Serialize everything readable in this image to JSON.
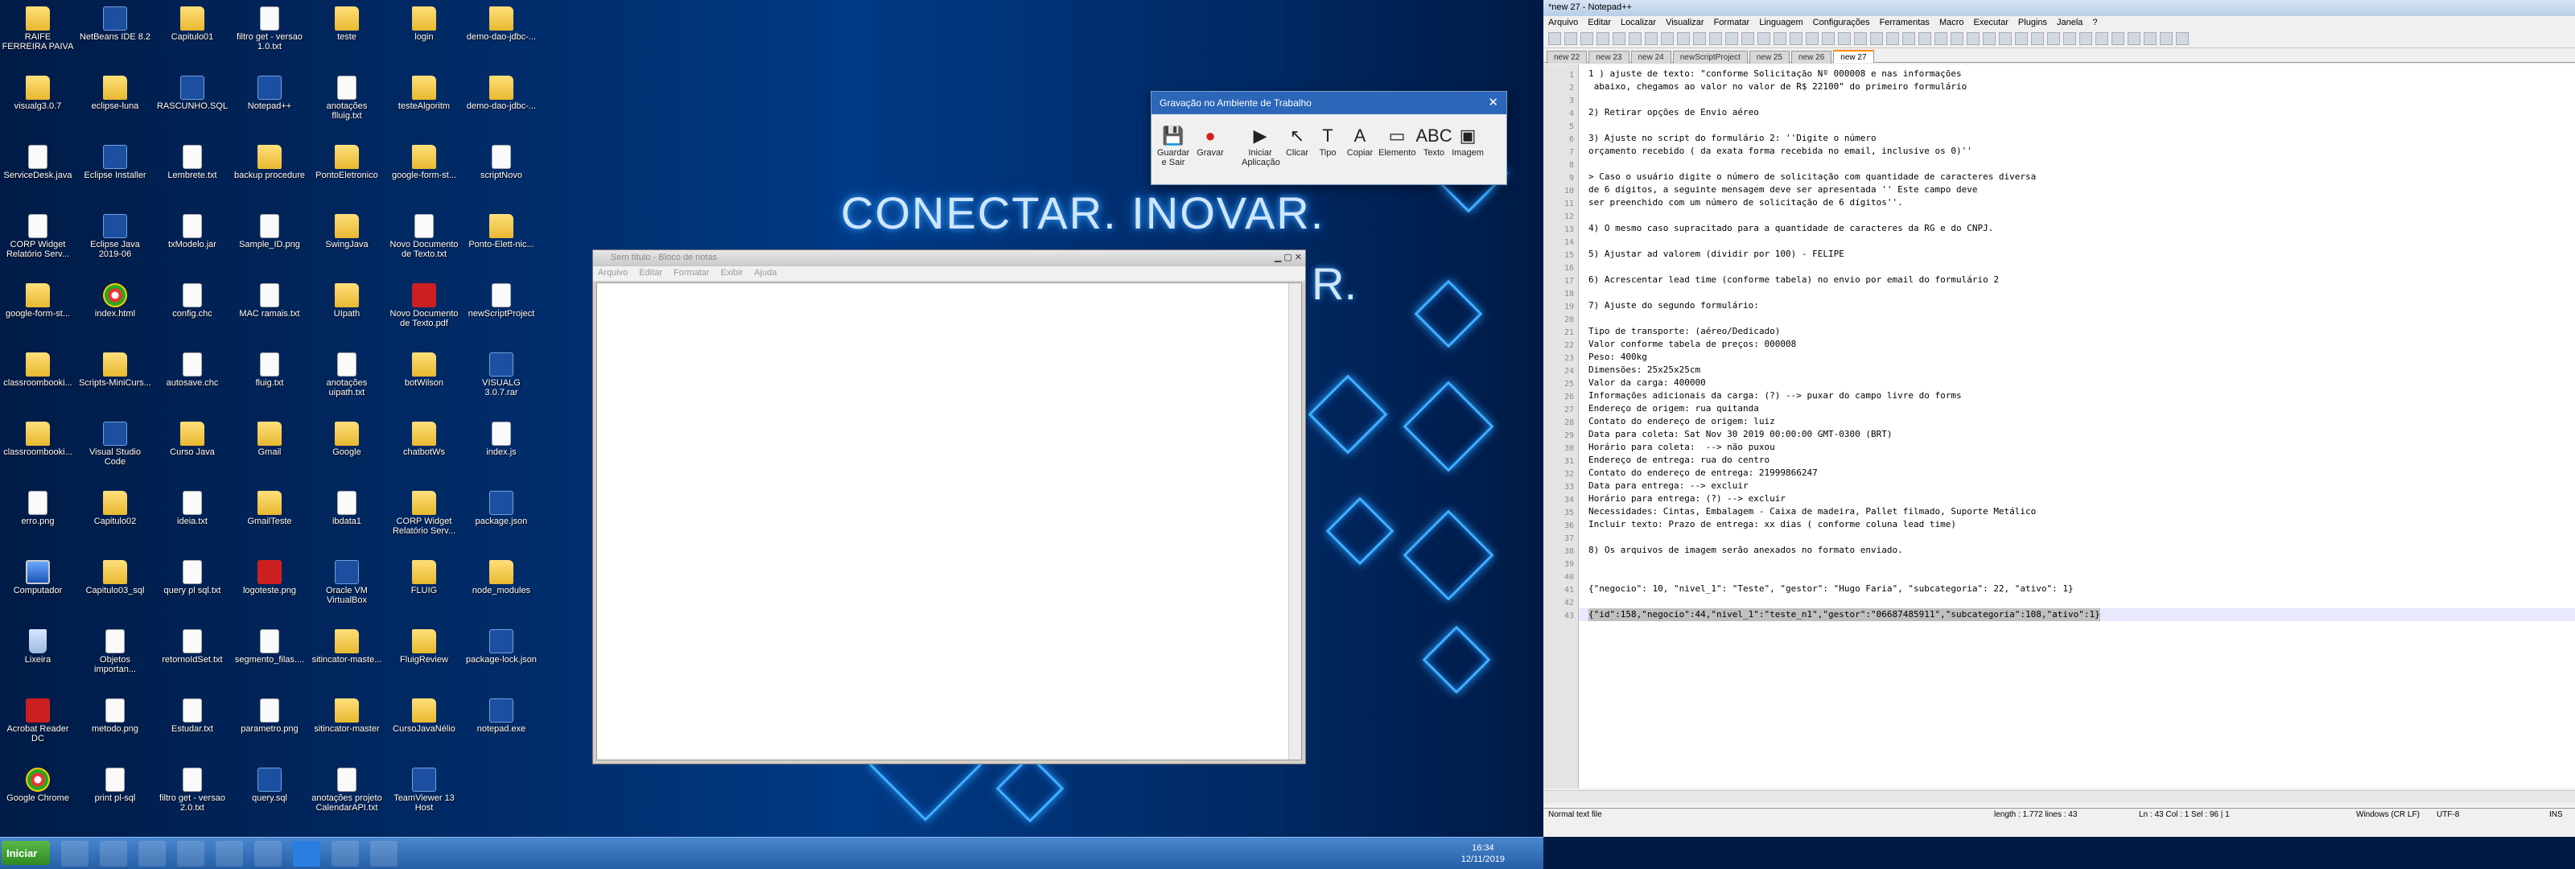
{
  "desktop": {
    "wallpaper_line1": "CONECTAR. INOVAR.",
    "wallpaper_line2": "R.",
    "icons": [
      {
        "label": "RAIFE FERREIRA PAIVA",
        "kind": "folder"
      },
      {
        "label": "NetBeans IDE 8.2",
        "kind": "app"
      },
      {
        "label": "Capitulo01",
        "kind": "folder"
      },
      {
        "label": "filtro get - versao 1.0.txt",
        "kind": "file"
      },
      {
        "label": "teste",
        "kind": "folder"
      },
      {
        "label": "login",
        "kind": "folder"
      },
      {
        "label": "demo-dao-jdbc-...",
        "kind": "folder"
      },
      {
        "label": "visualg3.0.7",
        "kind": "folder"
      },
      {
        "label": "eclipse-luna",
        "kind": "folder"
      },
      {
        "label": "RASCUNHO.SQL",
        "kind": "app"
      },
      {
        "label": "Notepad++",
        "kind": "app"
      },
      {
        "label": "anotações flluig.txt",
        "kind": "file"
      },
      {
        "label": "testeAlgoritm",
        "kind": "folder"
      },
      {
        "label": "demo-dao-jdbc-...",
        "kind": "folder"
      },
      {
        "label": "ServiceDesk.java",
        "kind": "file"
      },
      {
        "label": "Eclipse Installer",
        "kind": "app"
      },
      {
        "label": "Lembrete.txt",
        "kind": "file"
      },
      {
        "label": "backup procedure",
        "kind": "folder"
      },
      {
        "label": "PontoEletronico",
        "kind": "folder"
      },
      {
        "label": "google-form-st...",
        "kind": "folder"
      },
      {
        "label": "scriptNovo",
        "kind": "file"
      },
      {
        "label": "CORP Widget Relatório Serv...",
        "kind": "file"
      },
      {
        "label": "Eclipse Java 2019-06",
        "kind": "app"
      },
      {
        "label": "txModelo.jar",
        "kind": "file"
      },
      {
        "label": "Sample_ID.png",
        "kind": "file"
      },
      {
        "label": "SwingJava",
        "kind": "folder"
      },
      {
        "label": "Novo Documento de Texto.txt",
        "kind": "file"
      },
      {
        "label": "Ponto-Elett-nic...",
        "kind": "folder"
      },
      {
        "label": "google-form-st...",
        "kind": "folder"
      },
      {
        "label": "index.html",
        "kind": "web"
      },
      {
        "label": "config.chc",
        "kind": "file"
      },
      {
        "label": "MAC ramais.txt",
        "kind": "file"
      },
      {
        "label": "UIpath",
        "kind": "folder"
      },
      {
        "label": "Novo Documento de Texto.pdf",
        "kind": "red"
      },
      {
        "label": "newScriptProject",
        "kind": "file"
      },
      {
        "label": "classroombooki...",
        "kind": "folder"
      },
      {
        "label": "Scripts-MiniCurs...",
        "kind": "folder"
      },
      {
        "label": "autosave.chc",
        "kind": "file"
      },
      {
        "label": "fluig.txt",
        "kind": "file"
      },
      {
        "label": "anotações uipath.txt",
        "kind": "file"
      },
      {
        "label": "botWilson",
        "kind": "folder"
      },
      {
        "label": "VISUALG 3.0.7.rar",
        "kind": "app"
      },
      {
        "label": "classroombooki...",
        "kind": "folder"
      },
      {
        "label": "Visual Studio Code",
        "kind": "app"
      },
      {
        "label": "Curso Java",
        "kind": "folder"
      },
      {
        "label": "Gmail",
        "kind": "folder"
      },
      {
        "label": "Google",
        "kind": "folder"
      },
      {
        "label": "chatbotWs",
        "kind": "folder"
      },
      {
        "label": "index.js",
        "kind": "file"
      },
      {
        "label": "erro.png",
        "kind": "file"
      },
      {
        "label": "Capitulo02",
        "kind": "folder"
      },
      {
        "label": "ideia.txt",
        "kind": "file"
      },
      {
        "label": "GmailTeste",
        "kind": "folder"
      },
      {
        "label": "ibdata1",
        "kind": "file"
      },
      {
        "label": "CORP Widget Relatório Serv...",
        "kind": "folder"
      },
      {
        "label": "package.json",
        "kind": "app"
      },
      {
        "label": "Computador",
        "kind": "pc"
      },
      {
        "label": "Capitulo03_sql",
        "kind": "folder"
      },
      {
        "label": "query pl sql.txt",
        "kind": "file"
      },
      {
        "label": "logoteste.png",
        "kind": "red"
      },
      {
        "label": "Oracle VM VirtualBox",
        "kind": "app"
      },
      {
        "label": "FLUIG",
        "kind": "folder"
      },
      {
        "label": "node_modules",
        "kind": "folder"
      },
      {
        "label": "Lixeira",
        "kind": "trash"
      },
      {
        "label": "Objetos importan...",
        "kind": "file"
      },
      {
        "label": "retornoIdSet.txt",
        "kind": "file"
      },
      {
        "label": "segmento_filas....",
        "kind": "file"
      },
      {
        "label": "sitincator-maste...",
        "kind": "folder"
      },
      {
        "label": "FluigReview",
        "kind": "folder"
      },
      {
        "label": "package-lock.json",
        "kind": "app"
      },
      {
        "label": "Acrobat Reader DC",
        "kind": "red"
      },
      {
        "label": "metodo.png",
        "kind": "file"
      },
      {
        "label": "Estudar.txt",
        "kind": "file"
      },
      {
        "label": "parametro.png",
        "kind": "file"
      },
      {
        "label": "sitincator-master",
        "kind": "folder"
      },
      {
        "label": "CursoJavaNélio",
        "kind": "folder"
      },
      {
        "label": "notepad.exe",
        "kind": "app"
      },
      {
        "label": "Google Chrome",
        "kind": "web"
      },
      {
        "label": "print pl-sql",
        "kind": "file"
      },
      {
        "label": "filtro get - versao 2.0.txt",
        "kind": "file"
      },
      {
        "label": "query.sql",
        "kind": "app"
      },
      {
        "label": "anotações projeto CalendarAPI.txt",
        "kind": "file"
      },
      {
        "label": "TeamViewer 13 Host",
        "kind": "app"
      }
    ]
  },
  "recorder": {
    "title": "Gravação no Ambiente de Trabalho",
    "buttons": [
      {
        "label": "Guardar e Sair",
        "icon": "save-icon"
      },
      {
        "label": "Gravar",
        "icon": "record-icon"
      },
      {
        "label": "Iniciar Aplicação",
        "icon": "play-icon"
      },
      {
        "label": "Clicar",
        "icon": "cursor-icon"
      },
      {
        "label": "Tipo",
        "icon": "type-icon"
      },
      {
        "label": "Copiar",
        "icon": "copy-icon"
      },
      {
        "label": "Elemento",
        "icon": "element-icon"
      },
      {
        "label": "Texto",
        "icon": "text-icon"
      },
      {
        "label": "Imagem",
        "icon": "image-icon"
      }
    ]
  },
  "notepad": {
    "title": "Sem título - Bloco de notas",
    "menu": [
      "Arquivo",
      "Editar",
      "Formatar",
      "Exibir",
      "Ajuda"
    ]
  },
  "npp": {
    "title": "*new 27 - Notepad++",
    "menu": [
      "Arquivo",
      "Editar",
      "Localizar",
      "Visualizar",
      "Formatar",
      "Linguagem",
      "Configurações",
      "Ferramentas",
      "Macro",
      "Executar",
      "Plugins",
      "Janela",
      "?"
    ],
    "tabs": [
      "new 22",
      "new 23",
      "new 24",
      "newScriptProject",
      "new 25",
      "new 26",
      "new 27"
    ],
    "active_tab": "new 27",
    "lines": [
      "1 ) ajuste de texto: \"conforme Solicitação Nº 000008 e nas informações",
      " abaixo, chegamos ao valor no valor de R$ 22100\" do primeiro formulário",
      "",
      "2) Retirar opções de Envio aéreo",
      "",
      "3) Ajuste no script do formulário 2: ''Digite o número",
      "orçamento recebido ( da exata forma recebida no email, inclusive os 0)''",
      "",
      "> Caso o usuário digite o número de solicitação com quantidade de caracteres diversa",
      "de 6 dígitos, a seguinte mensagem deve ser apresentada '' Este campo deve",
      "ser preenchido com um número de solicitação de 6 dígitos''.",
      "",
      "4) O mesmo caso supracitado para a quantidade de caracteres da RG e do CNPJ.",
      "",
      "5) Ajustar ad valorem (dividir por 100) - FELIPE",
      "",
      "6) Acrescentar lead time (conforme tabela) no envio por email do formulário 2",
      "",
      "7) Ajuste do segundo formulário:",
      "",
      "Tipo de transporte: (aéreo/Dedicado)",
      "Valor conforme tabela de preços: 000008",
      "Peso: 400kg",
      "Dimensões: 25x25x25cm",
      "Valor da carga: 400000",
      "Informações adicionais da carga: (?) --> puxar do campo livre do forms",
      "Endereço de origem: rua quitanda",
      "Contato do endereço de origem: luiz",
      "Data para coleta: Sat Nov 30 2019 00:00:00 GMT-0300 (BRT)",
      "Horário para coleta:  --> não puxou",
      "Endereço de entrega: rua do centro",
      "Contato do endereço de entrega: 21999866247",
      "Data para entrega: --> excluir",
      "Horário para entrega: (?) --> excluir",
      "Necessidades: Cintas, Embalagem - Caixa de madeira, Pallet filmado, Suporte Metálico",
      "Incluir texto: Prazo de entrega: xx dias ( conforme coluna lead time)",
      "",
      "8) Os arquivos de imagem serão anexados no formato enviado.",
      "",
      "",
      "{\"negocio\": 10, \"nivel_1\": \"Teste\", \"gestor\": \"Hugo Faria\", \"subcategoria\": 22, \"ativo\": 1}",
      "",
      "{\"id\":158,\"negocio\":44,\"nivel_1\":\"teste_n1\",\"gestor\":\"06687485911\",\"subcategoria\":108,\"ativo\":1}"
    ],
    "status": {
      "type": "Normal text file",
      "length": "length : 1.772   lines : 43",
      "pos": "Ln : 43   Col : 1   Sel : 96 | 1",
      "eol": "Windows (CR LF)",
      "enc": "UTF-8",
      "ins": "INS"
    }
  },
  "taskbar": {
    "start": "Iniciar",
    "time": "16:34",
    "date": "12/11/2019"
  }
}
